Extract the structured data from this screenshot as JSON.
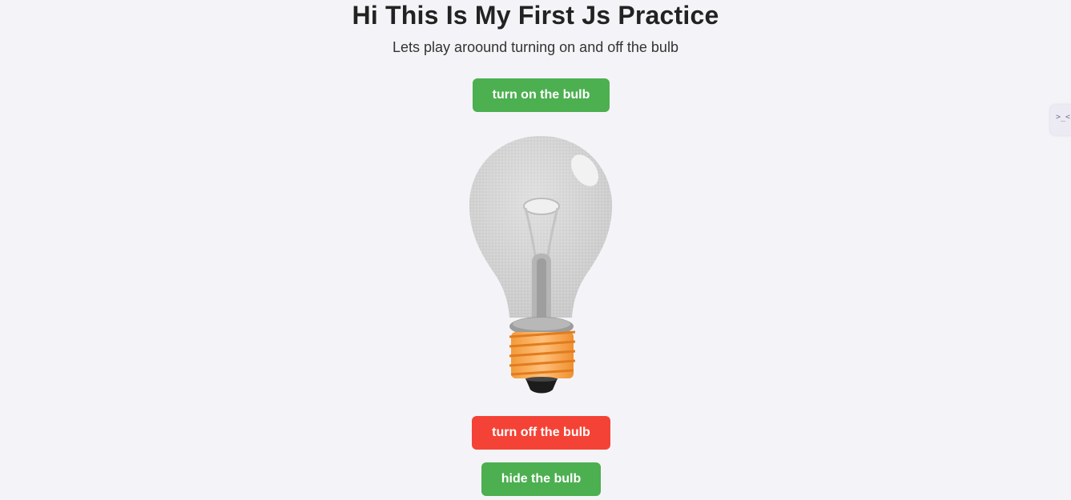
{
  "header": {
    "title": "Hi This Is My First Js Practice",
    "subtitle": "Lets play aroound turning on and off the bulb"
  },
  "buttons": {
    "turn_on": "turn on the bulb",
    "turn_off": "turn off the bulb",
    "hide": "hide the bulb"
  },
  "bulb": {
    "state": "off",
    "icon": "lightbulb-image"
  },
  "side_widget": {
    "icon": "terminal-icon",
    "glyph": ">_<"
  },
  "colors": {
    "background": "#f4f4f8",
    "on_button": "#4caf50",
    "off_button": "#f44336",
    "hide_button": "#4caf50",
    "bulb_base": "#f6a24a"
  }
}
